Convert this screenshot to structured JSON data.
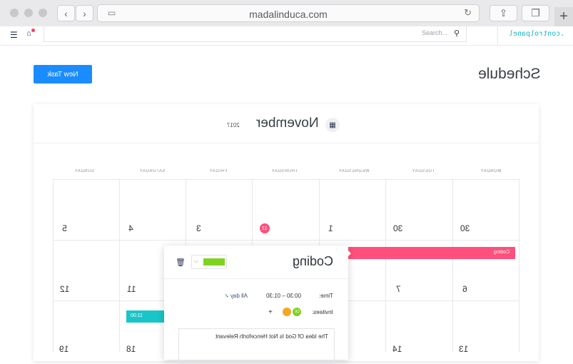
{
  "browser": {
    "url": "madalinduca.com"
  },
  "app": {
    "brand": ".controlpanel",
    "search_placeholder": "Search..."
  },
  "header": {
    "title": "Schedule",
    "new_task_label": "New Task"
  },
  "calendar": {
    "month": "November",
    "year": "2017",
    "weekdays": [
      "MONDAY",
      "TUESDAY",
      "WEDNESDAY",
      "THURSDAY",
      "FRIDAY",
      "SATURDAY",
      "SUNDAY"
    ],
    "rows": [
      [
        "30",
        "30",
        "1",
        "2",
        "3",
        "4",
        "5"
      ],
      [
        "6",
        "7",
        "",
        "",
        "",
        "11",
        "12"
      ],
      [
        "13",
        "14",
        "",
        "",
        "",
        "18",
        "19"
      ]
    ],
    "highlight_badge": "12",
    "events": [
      {
        "label": "Coding",
        "color": "#ff4f7b"
      },
      {
        "label": "11:00",
        "color": "#19c5c9"
      }
    ]
  },
  "popover": {
    "title": "Coding",
    "time_label": "Time:",
    "time_value": "00:30 – 01:30",
    "all_day_label": "All day",
    "invitees_label": "Invitees:",
    "invitee_initials": "CE",
    "notes": "The Idea Of God Is Not Henceforth Relevant",
    "color": "#7ed321"
  },
  "colors": {
    "primary": "#1a8cff",
    "brand": "#14b8c8",
    "event_pink": "#ff4f7b",
    "event_teal": "#19c5c9"
  }
}
